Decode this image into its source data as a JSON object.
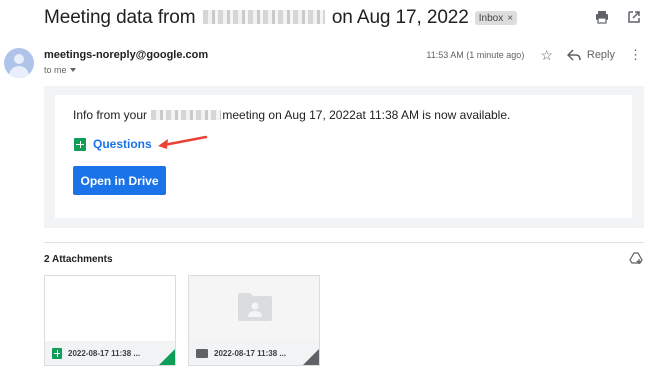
{
  "email": {
    "subject_prefix": "Meeting data from",
    "subject_suffix": "on Aug 17, 2022",
    "label_chip": "Inbox",
    "label_remove": "×",
    "sender": "meetings-noreply@google.com",
    "recipient": "to me",
    "timestamp": "11:53 AM (1 minute ago)",
    "reply_label": "Reply"
  },
  "body": {
    "info_prefix": "Info from your",
    "info_suffix": "meeting on Aug 17, 2022at 11:38 AM is now available.",
    "questions_link": "Questions",
    "open_drive_button": "Open in Drive"
  },
  "attachments": {
    "title": "2 Attachments",
    "items": [
      {
        "name": "2022-08-17 11:38 ...",
        "type": "sheet"
      },
      {
        "name": "2022-08-17 11:38 ...",
        "type": "file"
      }
    ]
  },
  "icons": {
    "print": "print-icon",
    "open_new_window": "open-in-new-window-icon",
    "star": "star-icon",
    "reply": "reply-icon",
    "more": "more-vertical-icon",
    "add_to_drive": "add-to-drive-icon"
  },
  "colors": {
    "link_blue": "#1a73e8",
    "sheets_green": "#0f9d58",
    "annotation_arrow": "#ea4335"
  }
}
